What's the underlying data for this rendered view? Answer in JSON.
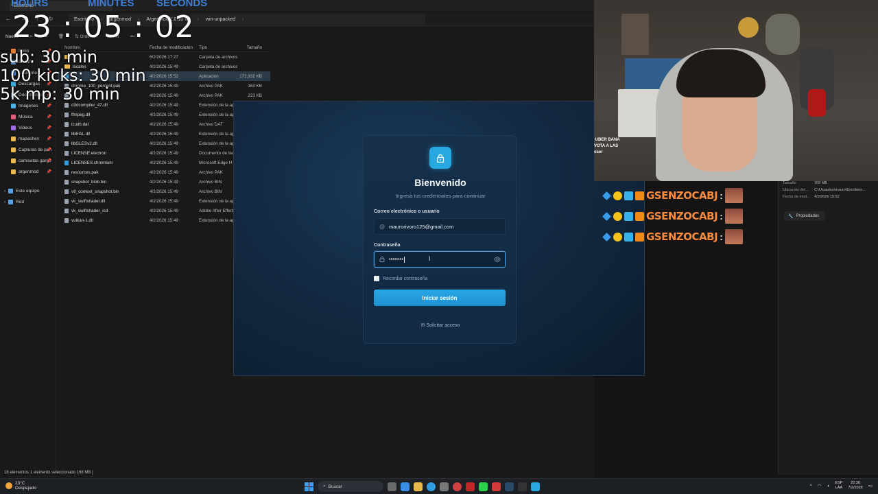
{
  "timer": {
    "labels": [
      "HOURS",
      "MINUTES",
      "SECONDS"
    ],
    "hours": "23",
    "minutes": "05",
    "seconds": "02"
  },
  "goals": [
    "sub: 30 min",
    "100 kicks: 30 min",
    "5k mp: 30 min"
  ],
  "explorer": {
    "tab_title": "Escritorio",
    "breadcrumbs": [
      "Escritorio",
      "argenmod",
      "ArgenMod 1.0.10 V2",
      "win-unpacked"
    ],
    "new_label": "Nuevo",
    "sort_label": "Ordenar",
    "view_label": "Ver",
    "columns": {
      "name": "Nombre",
      "date": "Fecha de modificación",
      "type": "Tipo",
      "size": "Tamaño"
    },
    "sidebar": [
      {
        "label": "Inicio",
        "color": "#e57d3a"
      },
      {
        "label": "Galería",
        "color": "#6aa0e8"
      },
      {
        "label": "Escritorio",
        "color": "#3b8de0"
      },
      {
        "label": "Descargas",
        "color": "#3bb2e0"
      },
      {
        "label": "Documentos",
        "color": "#7aa7e0"
      },
      {
        "label": "Imágenes",
        "color": "#4ab3e8"
      },
      {
        "label": "Música",
        "color": "#e05a7a"
      },
      {
        "label": "Videos",
        "color": "#9a6ae0"
      },
      {
        "label": "mapashex",
        "color": "#e8b84a"
      },
      {
        "label": "Capturas de pan",
        "color": "#e8b84a"
      },
      {
        "label": "camisetas gargo",
        "color": "#e8b84a"
      },
      {
        "label": "argenmod",
        "color": "#e8b84a"
      }
    ],
    "sidebar_sections": [
      "Este equipo",
      "Red"
    ],
    "files": [
      {
        "name": "",
        "date": "6/2/2026 17:27",
        "type": "Carpeta de archivos",
        "size": "",
        "kind": "folder"
      },
      {
        "name": "locales",
        "date": "4/2/2026 15:49",
        "type": "Carpeta de archivos",
        "size": "",
        "kind": "folder"
      },
      {
        "name": "",
        "date": "4/2/2026 15:52",
        "type": "Aplicación",
        "size": "172,932 KB",
        "kind": "app",
        "selected": true
      },
      {
        "name": "chrome_100_percent.pak",
        "date": "4/2/2026 15:49",
        "type": "Archivo PAK",
        "size": "164 KB",
        "kind": "file"
      },
      {
        "name": "",
        "date": "4/2/2026 15:49",
        "type": "Archivo PAK",
        "size": "223 KB",
        "kind": "file"
      },
      {
        "name": "d3dcompiler_47.dll",
        "date": "4/2/2026 15:49",
        "type": "Extensión de la apl",
        "size": "",
        "kind": "file"
      },
      {
        "name": "ffmpeg.dll",
        "date": "4/2/2026 15:49",
        "type": "Extensión de la apl",
        "size": "",
        "kind": "file"
      },
      {
        "name": "icudtl.dat",
        "date": "4/2/2026 15:49",
        "type": "Archivo DAT",
        "size": "",
        "kind": "file"
      },
      {
        "name": "libEGL.dll",
        "date": "4/2/2026 15:49",
        "type": "Extensión de la apl",
        "size": "",
        "kind": "file"
      },
      {
        "name": "libGLESv2.dll",
        "date": "4/2/2026 15:49",
        "type": "Extensión de la apl",
        "size": "",
        "kind": "file"
      },
      {
        "name": "LICENSE.electron",
        "date": "4/2/2026 15:49",
        "type": "Documento de tex",
        "size": "",
        "kind": "file"
      },
      {
        "name": "LICENSES.chromium",
        "date": "4/2/2026 15:49",
        "type": "Microsoft Edge H",
        "size": "",
        "kind": "edge"
      },
      {
        "name": "resources.pak",
        "date": "4/2/2026 15:49",
        "type": "Archivo PAK",
        "size": "",
        "kind": "file"
      },
      {
        "name": "snapshot_blob.bin",
        "date": "4/2/2026 15:49",
        "type": "Archivo BIN",
        "size": "",
        "kind": "file"
      },
      {
        "name": "v8_context_snapshot.bin",
        "date": "4/2/2026 15:49",
        "type": "Archivo BIN",
        "size": "",
        "kind": "file"
      },
      {
        "name": "vk_swiftshader.dll",
        "date": "4/2/2026 15:49",
        "type": "Extensión de la apl",
        "size": "",
        "kind": "file"
      },
      {
        "name": "vk_swiftshader_icd",
        "date": "4/2/2026 15:49",
        "type": "Adobe After Effect",
        "size": "",
        "kind": "file"
      },
      {
        "name": "vulkan-1.dll",
        "date": "4/2/2026 15:49",
        "type": "Extensión de la apl",
        "size": "",
        "kind": "file"
      }
    ],
    "status": "18 elementos   1 elemento seleccionado 168 MB  |",
    "details": [
      {
        "k": "Tamaño",
        "v": "168 MB"
      },
      {
        "k": "Ubicación del...",
        "v": "C:\\Usuarios\\mauro\\Escritorio..."
      },
      {
        "k": "Fecha de mod...",
        "v": "4/2/2026 15:52"
      }
    ],
    "properties_label": "Propiedades"
  },
  "login": {
    "title": "Bienvenido",
    "subtitle": "Ingresa tus credenciales para continuar",
    "email_label": "Correo electrónico o usuario",
    "email_value": "maurorivoro125@gmail.com",
    "password_label": "Contraseña",
    "password_value": "••••••••",
    "remember_label": "Recordar contraseña",
    "submit_label": "Iniciar sesión",
    "access_label": "Solicitar acceso",
    "accent": "#28a8e0"
  },
  "webcam_chat": {
    "lines": [
      " UBER BANA",
      "VOTA A LAS",
      "oser"
    ]
  },
  "chat": {
    "rows": [
      {
        "name": "GSENZOCABJ",
        "colon": ":"
      },
      {
        "name": "GSENZOCABJ",
        "colon": ":"
      },
      {
        "name": "GSENZOCABJ",
        "colon": ":"
      }
    ],
    "name_color": "#ff8a3c"
  },
  "taskbar": {
    "temperature": "23°C",
    "weather": "Despejado",
    "search_placeholder": "Buscar",
    "lang_top": "ESP",
    "lang_bottom": "LAA",
    "time": "22:36",
    "date": "7/2/2026"
  }
}
